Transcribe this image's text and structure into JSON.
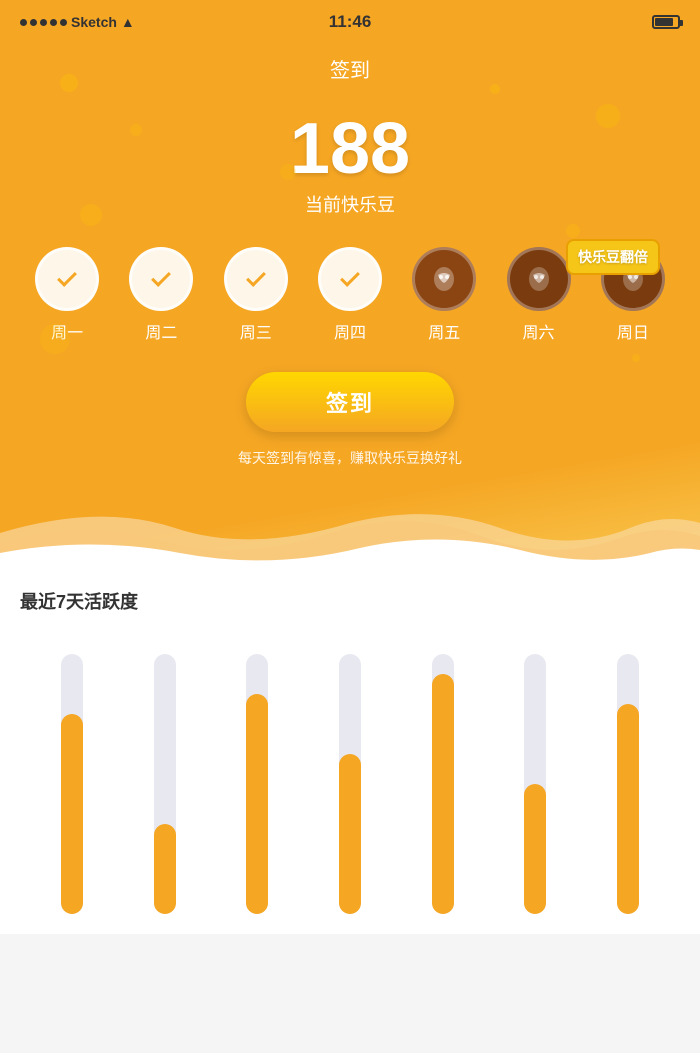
{
  "statusBar": {
    "appName": "Sketch",
    "time": "11:46",
    "signal": "●●●●●"
  },
  "header": {
    "title": "签到",
    "doubleBadge": "快乐豆翻倍"
  },
  "points": {
    "number": "188",
    "label": "当前快乐豆"
  },
  "days": [
    {
      "label": "周一",
      "type": "checked"
    },
    {
      "label": "周二",
      "type": "checked"
    },
    {
      "label": "周三",
      "type": "checked"
    },
    {
      "label": "周四",
      "type": "checked"
    },
    {
      "label": "周五",
      "type": "bean"
    },
    {
      "label": "周六",
      "type": "bean-dark"
    },
    {
      "label": "周日",
      "type": "bean-dark"
    }
  ],
  "checkinButton": "签到",
  "subtitle": "每天签到有惊喜，赚取快乐豆换好礼",
  "activitySection": {
    "title": "最近7天活跃度",
    "bars": [
      {
        "track": 260,
        "fill": 200
      },
      {
        "track": 260,
        "fill": 90
      },
      {
        "track": 260,
        "fill": 220
      },
      {
        "track": 260,
        "fill": 160
      },
      {
        "track": 260,
        "fill": 240
      },
      {
        "track": 260,
        "fill": 130
      },
      {
        "track": 260,
        "fill": 210
      }
    ]
  }
}
